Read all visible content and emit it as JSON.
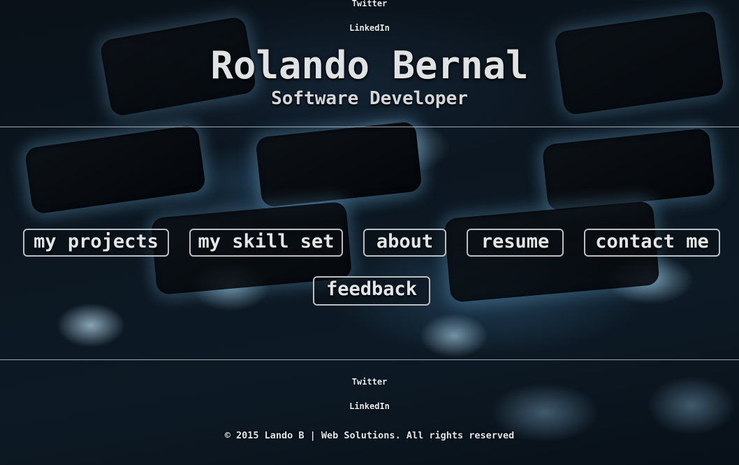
{
  "header": {
    "social_links": [
      "Twitter",
      "LinkedIn"
    ],
    "title": "Rolando Bernal",
    "subtitle": "Software Developer"
  },
  "nav": {
    "buttons": [
      "my projects",
      "my skill set",
      "about",
      "resume",
      "contact me",
      "feedback"
    ]
  },
  "footer": {
    "social_links": [
      "Twitter",
      "LinkedIn"
    ],
    "copyright": "© 2015 Lando B | Web Solutions. All rights reserved"
  },
  "colors": {
    "text": "#e3e6e7",
    "button_border": "#b9bfc2",
    "glow": "#78b9e1"
  }
}
